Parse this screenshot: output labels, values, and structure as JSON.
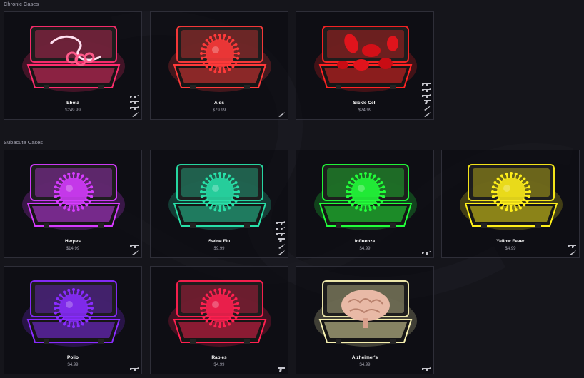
{
  "sections": [
    {
      "title": "Chronic Cases"
    },
    {
      "title": "Subacute Cases"
    }
  ],
  "cases": [
    {
      "name": "Ebola",
      "price": "$249.99",
      "glow": "#ff2d6e",
      "icon": "ebola-icon",
      "weapons": [
        "rifle-icon",
        "rifle-icon",
        "rifle-icon",
        "knife-icon"
      ]
    },
    {
      "name": "Aids",
      "price": "$79.99",
      "glow": "#ff3a3a",
      "icon": "virus-icon",
      "weapons": [
        "knife-icon"
      ]
    },
    {
      "name": "Sickle Cell",
      "price": "$24.99",
      "glow": "#ff2424",
      "icon": "blood-cells-icon",
      "weapons": [
        "rifle-icon",
        "rifle-icon",
        "rifle-icon",
        "pistol-icon",
        "knife-icon",
        "knife-icon"
      ]
    },
    {
      "name": "Herpes",
      "price": "$14.99",
      "glow": "#d63cff",
      "icon": "virus-icon",
      "weapons": [
        "rifle-icon",
        "knife-icon"
      ]
    },
    {
      "name": "Swine Flu",
      "price": "$9.99",
      "glow": "#28e0a8",
      "icon": "virus-icon",
      "weapons": [
        "rifle-icon",
        "rifle-icon",
        "rifle-icon",
        "pistol-icon",
        "knife-icon",
        "knife-icon"
      ]
    },
    {
      "name": "Influenza",
      "price": "$4.99",
      "glow": "#22ff3a",
      "icon": "virus-icon",
      "weapons": [
        "rifle-icon"
      ]
    },
    {
      "name": "Yellow Fever",
      "price": "$4.99",
      "glow": "#ffef1a",
      "icon": "virus-icon",
      "weapons": [
        "rifle-icon",
        "knife-icon"
      ]
    },
    {
      "name": "Polio",
      "price": "$4.99",
      "glow": "#8a2cff",
      "icon": "virus-icon",
      "weapons": [
        "rifle-icon"
      ]
    },
    {
      "name": "Rabies",
      "price": "$4.99",
      "glow": "#ff2050",
      "icon": "virus-icon",
      "weapons": [
        "pistol-icon"
      ]
    },
    {
      "name": "Alzheimer's",
      "price": "$4.99",
      "glow": "#f6f0b0",
      "icon": "brain-icon",
      "weapons": [
        "rifle-icon"
      ]
    }
  ]
}
